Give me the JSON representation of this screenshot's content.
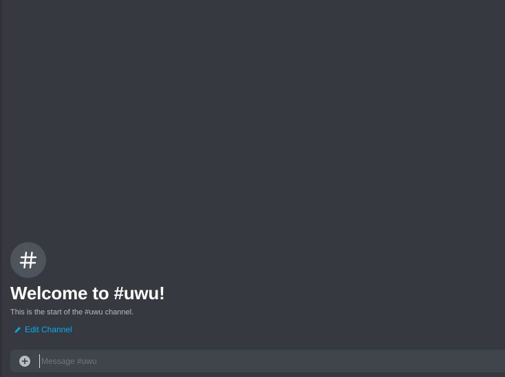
{
  "welcome": {
    "avatar_icon": "hashtag-icon",
    "title": "Welcome to #uwu!",
    "subtitle": "This is the start of the #uwu channel.",
    "edit_label": "Edit Channel"
  },
  "composer": {
    "attach_icon": "plus-circle-icon",
    "placeholder": "Message #uwu",
    "value": ""
  },
  "colors": {
    "background": "#36393f",
    "input_background": "#40444b",
    "link": "#00b0f4",
    "title": "#ffffff",
    "muted": "#b9bbbe"
  }
}
